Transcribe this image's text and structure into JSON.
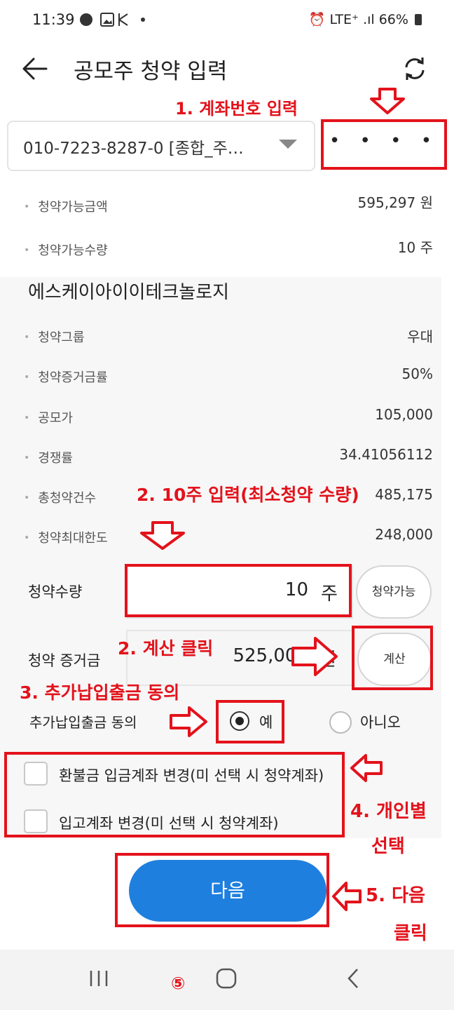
{
  "status_bar": {
    "time": "11:39",
    "right": "LTE⁺ .ıl 66%"
  },
  "header": {
    "title": "공모주 청약 입력"
  },
  "account": {
    "selected": "010-7223-8287-0 [종합_주…",
    "password_dots": "• • • •"
  },
  "balance_rows": [
    {
      "label": "청약가능금액",
      "value": "595,297 원"
    },
    {
      "label": "청약가능수량",
      "value": "10 주"
    }
  ],
  "company_name": "에스케이아이이테크놀로지",
  "detail_rows": [
    {
      "label": "청약그룹",
      "value": "우대"
    },
    {
      "label": "청약증거금률",
      "value": "50%"
    },
    {
      "label": "공모가",
      "value": "105,000"
    },
    {
      "label": "경쟁률",
      "value": "34.41056112"
    },
    {
      "label": "총청약건수",
      "value": "485,175"
    },
    {
      "label": "청약최대한도",
      "value": "248,000"
    }
  ],
  "quantity": {
    "label": "청약수량",
    "value": "10",
    "unit": "주",
    "max_button": "청약가능"
  },
  "deposit": {
    "label": "청약 증거금",
    "value": "525,000",
    "unit": "원",
    "calc_button": "계산"
  },
  "consent": {
    "label": "추가납입출금 동의",
    "yes": "예",
    "no": "아니오",
    "selected": "yes"
  },
  "checkboxes": [
    {
      "label": "환불금 입금계좌 변경(미 선택 시 청약계좌)",
      "checked": false
    },
    {
      "label": "입고계좌 변경(미 선택 시 청약계좌)",
      "checked": false
    }
  ],
  "next_button": "다음",
  "navbar": {
    "step_mark": "⑤"
  },
  "annotations": {
    "step1": "1. 계좌번호 입력",
    "step2a": "2. 10주 입력(최소청약 수량)",
    "step2b": "2. 계산 클릭",
    "step3": "3. 추가납입출금 동의",
    "step4_line1": "4. 개인별",
    "step4_line2": "선택",
    "step5_line1": "5. 다음",
    "step5_line2": "클릭"
  },
  "colors": {
    "accent": "#1f7fde",
    "annotation": "#e3121b"
  }
}
